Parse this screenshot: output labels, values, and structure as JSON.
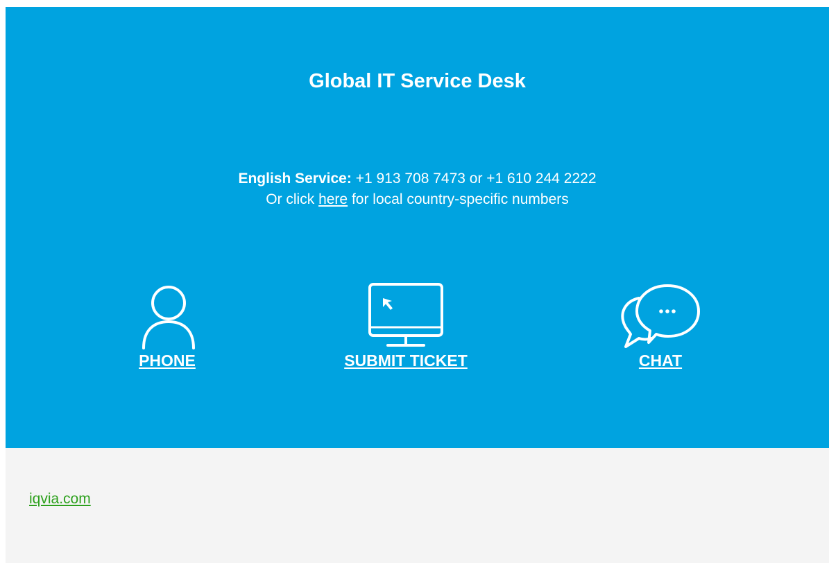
{
  "banner": {
    "title": "Global IT Service Desk",
    "service_label": "English Service:",
    "service_numbers": "+1 913 708 7473 or +1 610 244 2222",
    "local_prefix": "Or click",
    "local_link": "here",
    "local_suffix": "for local country-specific numbers",
    "background_color": "#00a3e0"
  },
  "actions": [
    {
      "label": "PHONE",
      "icon": "person-icon"
    },
    {
      "label": "SUBMIT TICKET",
      "icon": "monitor-icon"
    },
    {
      "label": "CHAT",
      "icon": "chat-bubbles-icon"
    }
  ],
  "footer": {
    "link": "iqvia.com",
    "link_color": "#2ca01c",
    "background_color": "#f4f4f4"
  }
}
